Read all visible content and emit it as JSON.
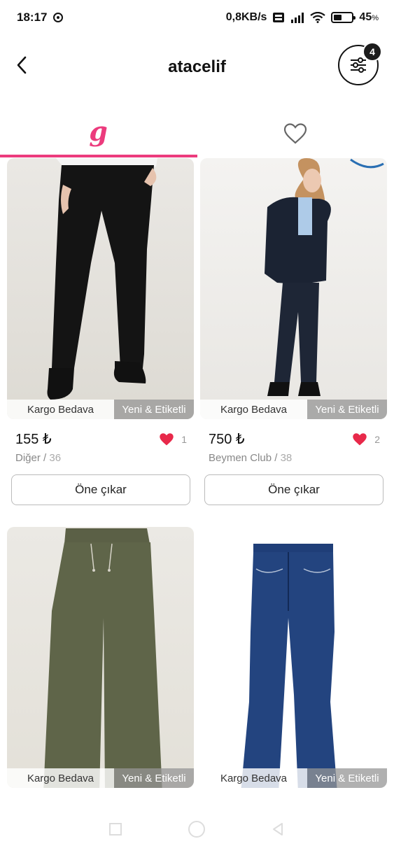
{
  "status_bar": {
    "time": "18:17",
    "net_speed": "0,8KB/s",
    "battery_percent": "45",
    "battery_sign": "%",
    "battery_level": 0.45,
    "icons": [
      "notification-icon",
      "volte-icon",
      "signal-icon",
      "wifi-icon",
      "battery-icon"
    ]
  },
  "header": {
    "title": "atacelif",
    "filter_badge": "4",
    "icons": [
      "back-arrow-icon",
      "filter-sliders-icon"
    ]
  },
  "tabs": {
    "items": [
      {
        "name": "closet",
        "glyph": "g",
        "active": true
      },
      {
        "name": "favorites",
        "icon": "heart-outline-icon",
        "active": false
      }
    ],
    "accent": "#ec3b7d"
  },
  "products": [
    {
      "cargo_tag": "Kargo Bedava",
      "condition_tag": "Yeni & Etiketli",
      "price": "155 ₺",
      "likes": "1",
      "brand": "Diğer",
      "separator": " / ",
      "size": "36",
      "button": "Öne çıkar"
    },
    {
      "cargo_tag": "Kargo Bedava",
      "condition_tag": "Yeni & Etiketli",
      "price": "750 ₺",
      "likes": "2",
      "brand": "Beymen Club",
      "separator": " / ",
      "size": "38",
      "button": "Öne çıkar"
    },
    {
      "cargo_tag": "Kargo Bedava",
      "condition_tag": "Yeni & Etiketli"
    },
    {
      "cargo_tag": "Kargo Bedava",
      "condition_tag": "Yeni & Etiketli"
    }
  ],
  "colors": {
    "accent_pink": "#ec3b7d",
    "heart_red": "#e8294a"
  },
  "nav_bar": {
    "icons": [
      "recents-square-icon",
      "home-circle-icon",
      "back-triangle-icon"
    ]
  }
}
